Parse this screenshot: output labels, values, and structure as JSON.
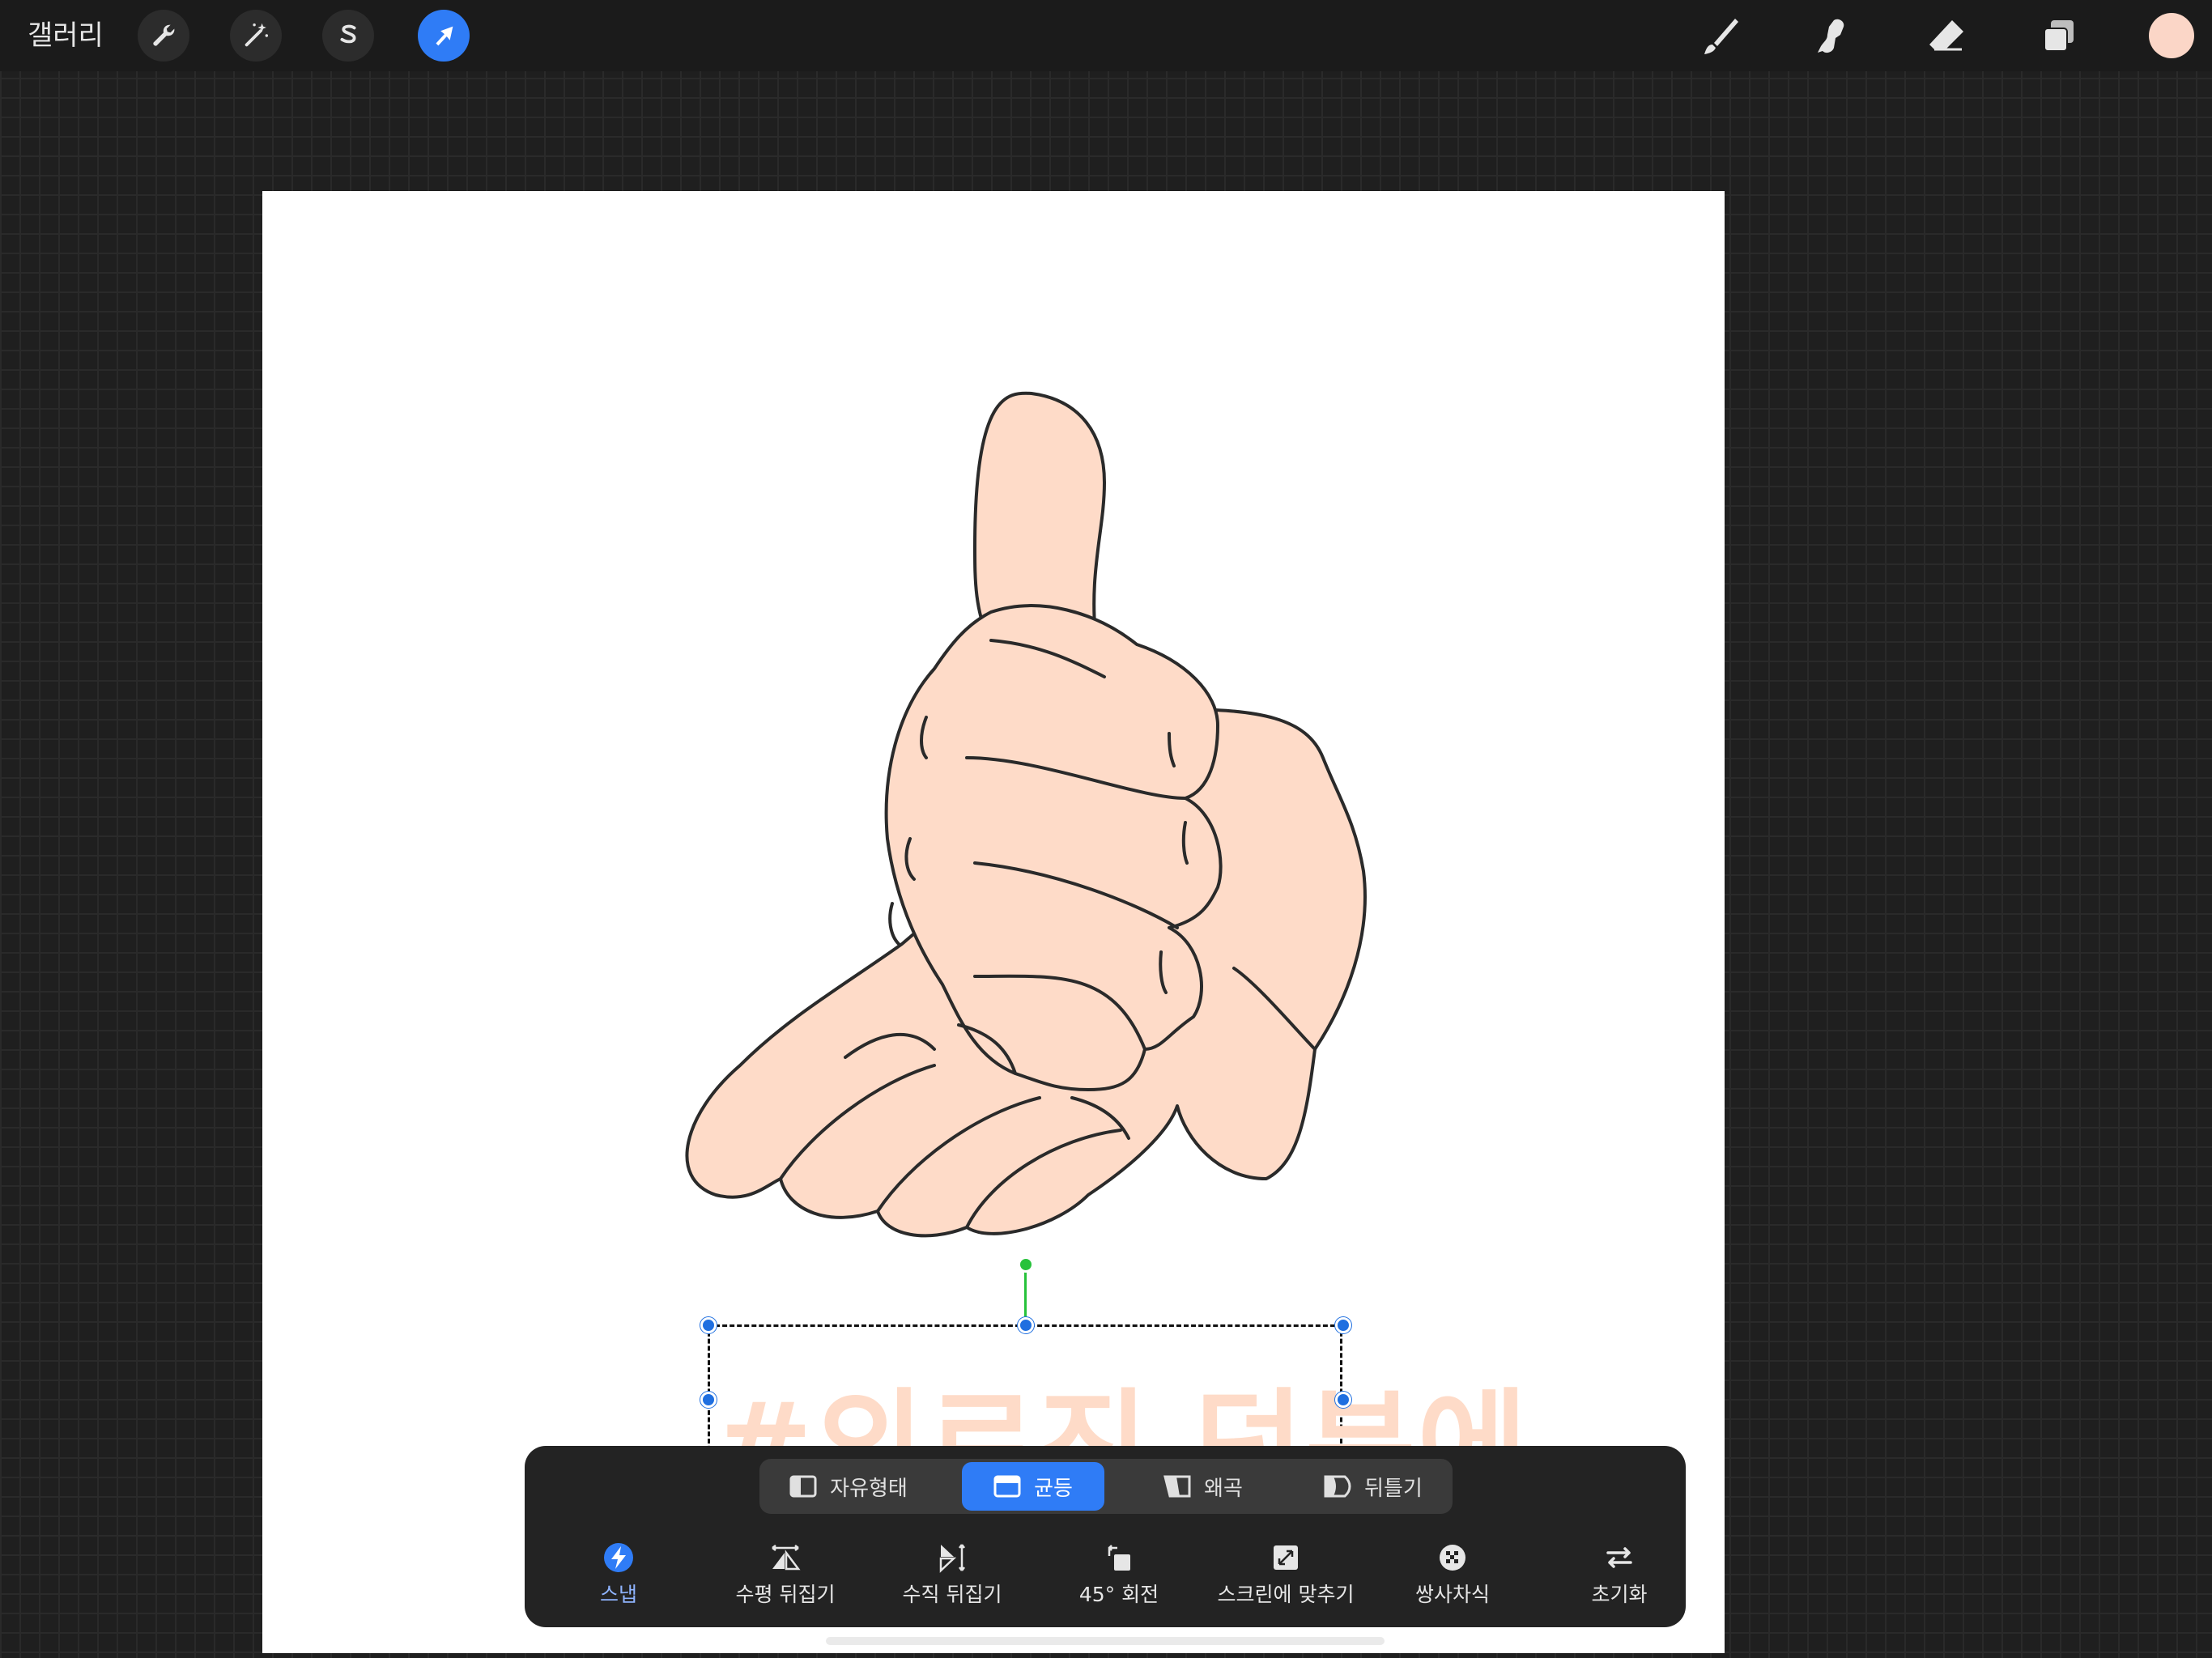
{
  "topbar": {
    "gallery_label": "갤러리",
    "tools_left": [
      {
        "name": "actions",
        "icon": "wrench-icon"
      },
      {
        "name": "adjustments",
        "icon": "magic-wand-icon"
      },
      {
        "name": "selection",
        "icon": "selection-s-icon"
      },
      {
        "name": "transform",
        "icon": "arrow-cursor-icon",
        "active": true
      }
    ],
    "tools_right": [
      {
        "name": "brush",
        "icon": "brush-icon"
      },
      {
        "name": "smudge",
        "icon": "smudge-icon"
      },
      {
        "name": "eraser",
        "icon": "eraser-icon"
      },
      {
        "name": "layers",
        "icon": "layers-icon"
      }
    ],
    "current_color": "#fbd6c7"
  },
  "canvas": {
    "text": "#의료진 덕분에",
    "skin_color": "#fedbc8",
    "line_color": "#2a2a2a"
  },
  "transform_panel": {
    "modes": [
      {
        "label": "자유형태",
        "icon": "freeform-icon",
        "active": false
      },
      {
        "label": "균등",
        "icon": "uniform-icon",
        "active": true
      },
      {
        "label": "왜곡",
        "icon": "distort-icon",
        "active": false
      },
      {
        "label": "뒤틀기",
        "icon": "warp-icon",
        "active": false
      }
    ],
    "actions": [
      {
        "label": "스냅",
        "icon": "snap-lightning-icon",
        "active": true
      },
      {
        "label": "수평 뒤집기",
        "icon": "flip-horizontal-icon"
      },
      {
        "label": "수직 뒤집기",
        "icon": "flip-vertical-icon"
      },
      {
        "label": "45° 회전",
        "icon": "rotate-45-icon"
      },
      {
        "label": "스크린에 맞추기",
        "icon": "fit-to-screen-icon"
      },
      {
        "label": "쌍사차식",
        "icon": "interpolation-icon"
      },
      {
        "label": "초기화",
        "icon": "reset-icon"
      }
    ]
  },
  "colors": {
    "accent": "#2f7cf6",
    "rotate_handle": "#27c23b",
    "panel_bg": "#232323"
  }
}
